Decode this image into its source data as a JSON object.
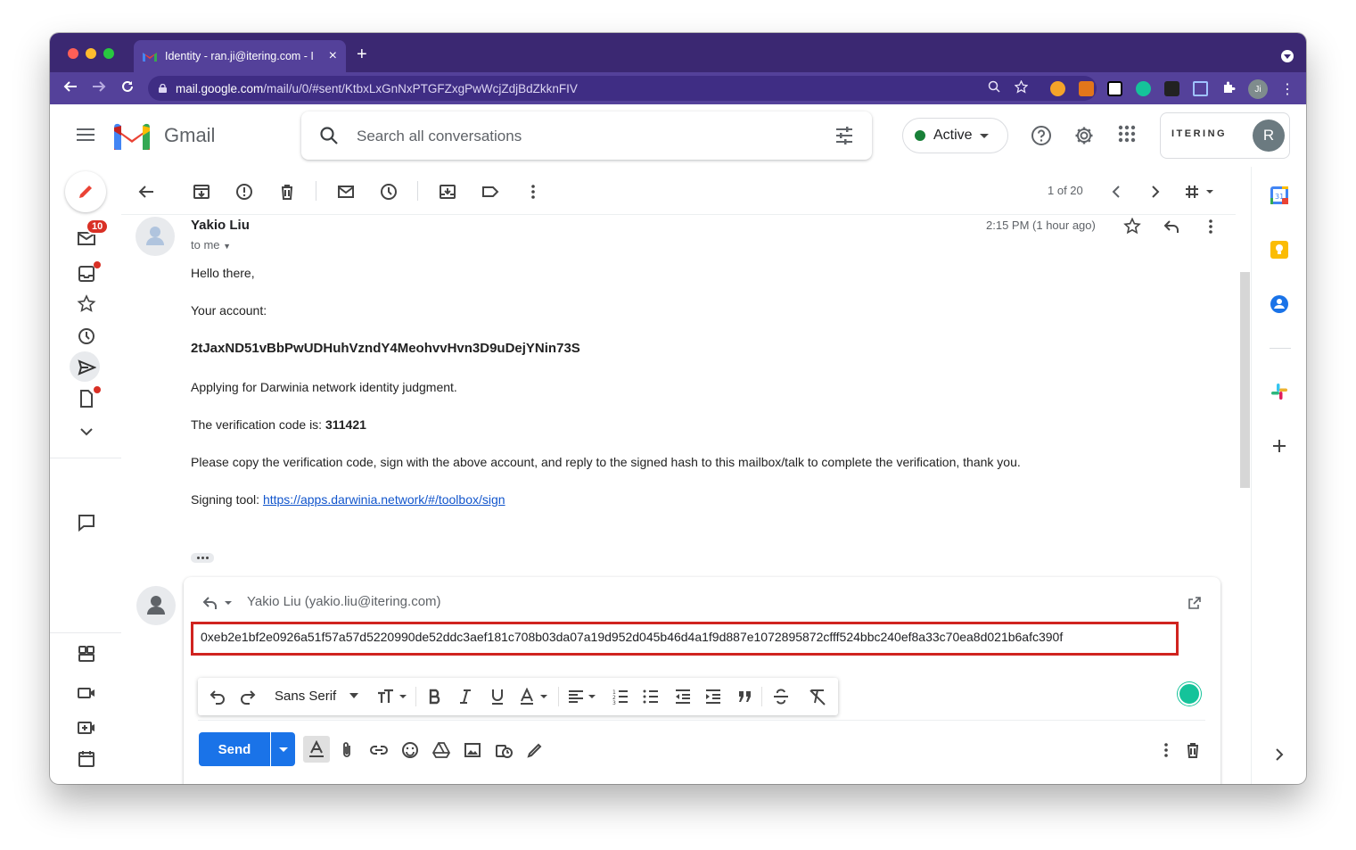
{
  "browser": {
    "tab_title": "Identity - ran.ji@itering.com - I",
    "url_host": "mail.google.com",
    "url_path": "/mail/u/0/#sent/KtbxLxGnNxPTGFZxgPwWcjZdjBdZkknFIV",
    "profile_initials": "Ji",
    "icons": [
      "back-icon",
      "forward-icon",
      "reload-icon",
      "lock-icon",
      "zoom-icon",
      "bookmark-star-icon",
      "extensions-icon"
    ]
  },
  "gmail": {
    "product_name": "Gmail",
    "search_placeholder": "Search all conversations",
    "status_label": "Active",
    "status_color": "#188038",
    "org_brand": "ITERING",
    "account_initial": "R",
    "unread_badge": "10"
  },
  "toolbar": {
    "pager": "1 of 20"
  },
  "message": {
    "sender_name": "Yakio Liu",
    "to_label": "to me",
    "timestamp": "2:15 PM (1 hour ago)",
    "greeting": "Hello there,",
    "account_label": "Your account:",
    "account_value": "2tJaxND51vBbPwUDHuhVzndY4MeohvvHvn3D9uDejYNin73S",
    "purpose": "Applying for Darwinia network identity judgment.",
    "code_prefix": "The verification code is: ",
    "code_value": "311421",
    "instructions": "Please copy the verification code, sign with the above account, and reply to the signed hash to this mailbox/talk to complete the verification, thank you.",
    "tool_prefix": "Signing tool: ",
    "tool_link": "https://apps.darwinia.network/#/toolbox/sign"
  },
  "reply": {
    "recipient": "Yakio Liu (yakio.liu@itering.com)",
    "body": "0xeb2e1bf2e0926a51f57a57d5220990de52ddc3aef181c708b03da07a19d952d045b46d4a1f9d887e1072895872cfff524bbc240ef8a33c70ea8d021b6afc390f",
    "font_name": "Sans Serif",
    "send_label": "Send",
    "highlight_color": "#d0231f"
  }
}
